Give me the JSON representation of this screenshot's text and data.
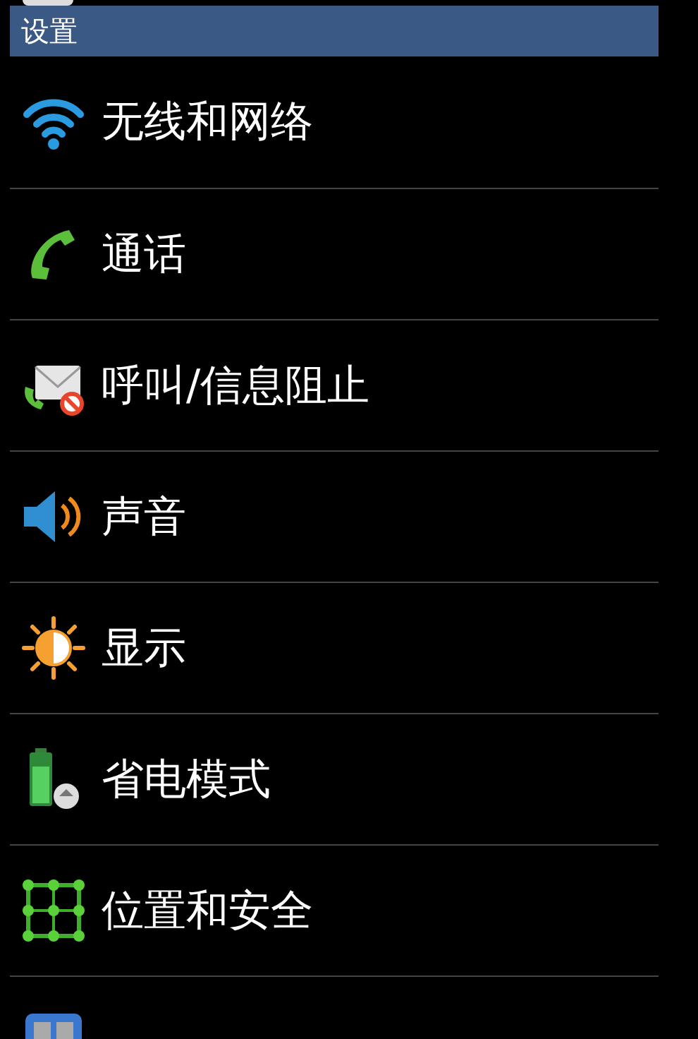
{
  "title_bar": {
    "title": "设置"
  },
  "items": [
    {
      "label": "无线和网络",
      "kind": "wifi"
    },
    {
      "label": "通话",
      "kind": "phone"
    },
    {
      "label": "呼叫/信息阻止",
      "kind": "block"
    },
    {
      "label": "声音",
      "kind": "sound"
    },
    {
      "label": "显示",
      "kind": "display"
    },
    {
      "label": "省电模式",
      "kind": "battery"
    },
    {
      "label": "位置和安全",
      "kind": "location"
    },
    {
      "kind": "apps"
    }
  ]
}
